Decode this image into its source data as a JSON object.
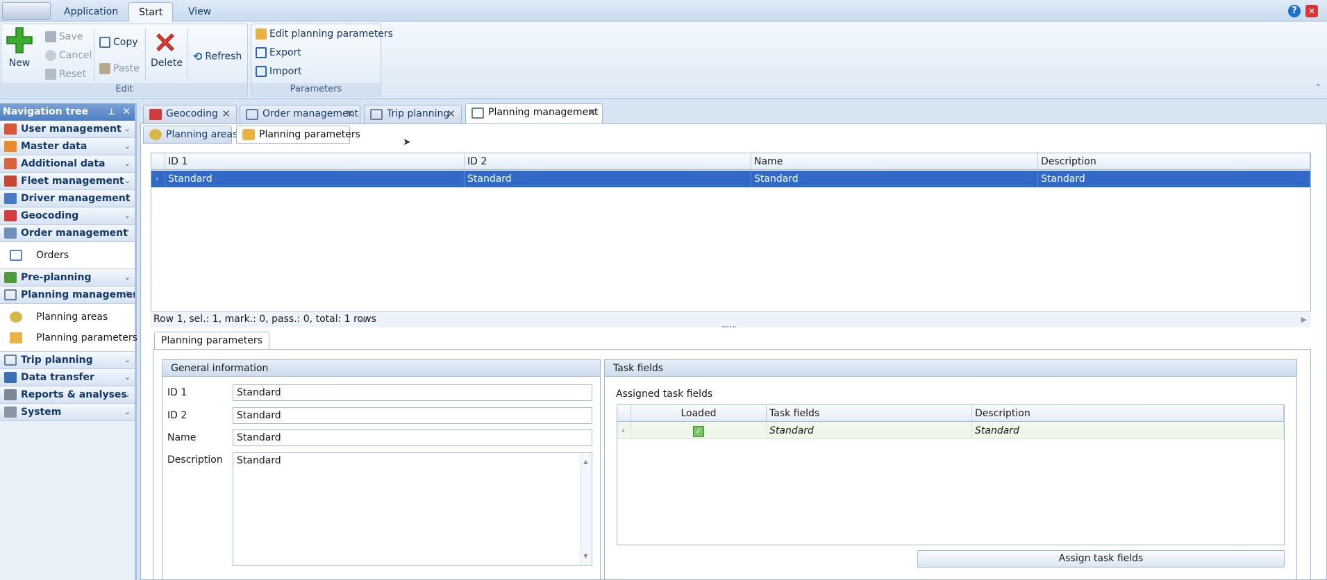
{
  "ribbon_tabs": [
    "Application",
    "Start",
    "View"
  ],
  "ribbon": {
    "edit_group": {
      "caption": "Edit",
      "new": "New",
      "save": "Save",
      "cancel": "Cancel",
      "reset": "Reset",
      "copy": "Copy",
      "paste": "Paste",
      "delete": "Delete",
      "refresh": "Refresh"
    },
    "parameters_group": {
      "caption": "Parameters",
      "edit_planning_parameters": "Edit planning parameters",
      "export": "Export",
      "import": "Import"
    }
  },
  "nav": {
    "title": "Navigation tree",
    "groups": [
      {
        "label": "User management"
      },
      {
        "label": "Master data"
      },
      {
        "label": "Additional data"
      },
      {
        "label": "Fleet management"
      },
      {
        "label": "Driver management"
      },
      {
        "label": "Geocoding"
      },
      {
        "label": "Order management",
        "children": [
          "Orders"
        ]
      },
      {
        "label": "Pre-planning"
      },
      {
        "label": "Planning management",
        "children": [
          "Planning areas",
          "Planning parameters"
        ]
      },
      {
        "label": "Trip planning"
      },
      {
        "label": "Data transfer"
      },
      {
        "label": "Reports & analyses"
      },
      {
        "label": "System"
      }
    ]
  },
  "doc_tabs": [
    "Geocoding",
    "Order management",
    "Trip planning",
    "Planning management"
  ],
  "sub_tabs": [
    "Planning areas",
    "Planning parameters"
  ],
  "grid": {
    "columns": [
      "ID 1",
      "ID 2",
      "Name",
      "Description"
    ],
    "rows": [
      [
        "Standard",
        "Standard",
        "Standard",
        "Standard"
      ]
    ],
    "status": "Row 1, sel.: 1, mark.: 0, pass.: 0, total: 1 rows"
  },
  "detail": {
    "tab": "Planning parameters",
    "general": {
      "title": "General information",
      "id1_label": "ID 1",
      "id1_value": "Standard",
      "id2_label": "ID 2",
      "id2_value": "Standard",
      "name_label": "Name",
      "name_value": "Standard",
      "desc_label": "Description",
      "desc_value": "Standard"
    },
    "task_fields": {
      "title": "Task fields",
      "assigned_label": "Assigned task fields",
      "columns": [
        "Loaded",
        "Task fields",
        "Description"
      ],
      "rows": [
        [
          "Standard",
          "Standard"
        ]
      ],
      "assign_button": "Assign task fields"
    }
  }
}
